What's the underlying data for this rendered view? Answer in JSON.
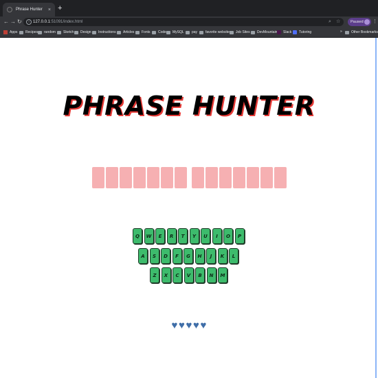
{
  "browser": {
    "tab_title": "Phrase Hunter",
    "tab_close": "×",
    "new_tab": "+",
    "url_host": "127.0.0.1",
    "url_rest": ":51091/index.html",
    "profile_status": "Paused",
    "bookmarks": [
      "Apps",
      "Recipes",
      "random",
      "Sketch",
      "Design",
      "Instructions",
      "Articles",
      "Fonts",
      "Code",
      "MySQL",
      "pay",
      "favorite websites",
      "Job Sites",
      "DevMountain",
      "Slack",
      "Tutoring"
    ],
    "other_bookmarks": "Other Bookmarks"
  },
  "game": {
    "title": "PHRASE HUNTER",
    "phrase_word_lengths": [
      7,
      7
    ],
    "keyboard": {
      "row1": [
        "Q",
        "W",
        "E",
        "R",
        "T",
        "Y",
        "U",
        "I",
        "O",
        "P"
      ],
      "row2": [
        "A",
        "S",
        "D",
        "F",
        "G",
        "H",
        "J",
        "K",
        "L"
      ],
      "row3": [
        "Z",
        "X",
        "C",
        "V",
        "B",
        "N",
        "M"
      ]
    },
    "lives": 5
  },
  "colors": {
    "tile": "#f6b0b2",
    "key": "#3dbb6c",
    "heart": "#3f6ea8",
    "title_shadow": "#e53935"
  }
}
